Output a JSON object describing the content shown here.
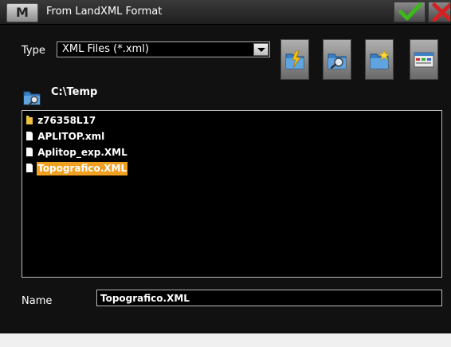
{
  "window": {
    "title": "From LandXML Format",
    "menu_button_label": "M"
  },
  "type_field": {
    "label": "Type",
    "value": "XML Files (*.xml)"
  },
  "toolbar": {
    "icons": [
      "open-file-icon",
      "browse-folder-icon",
      "new-folder-icon",
      "view-options-icon"
    ]
  },
  "path": {
    "current": "C:\\Temp"
  },
  "files": [
    {
      "name": "z76358L17",
      "type": "folder",
      "selected": false
    },
    {
      "name": "APLITOP.xml",
      "type": "file",
      "selected": false
    },
    {
      "name": "Aplitop_exp.XML",
      "type": "file",
      "selected": false
    },
    {
      "name": "Topografico.XML",
      "type": "file",
      "selected": true
    }
  ],
  "name_field": {
    "label": "Name",
    "value": "Topografico.XML"
  },
  "colors": {
    "background": "#111111",
    "selection": "#f0a020",
    "ok_check": "#3db81c",
    "close_x": "#d62020"
  }
}
